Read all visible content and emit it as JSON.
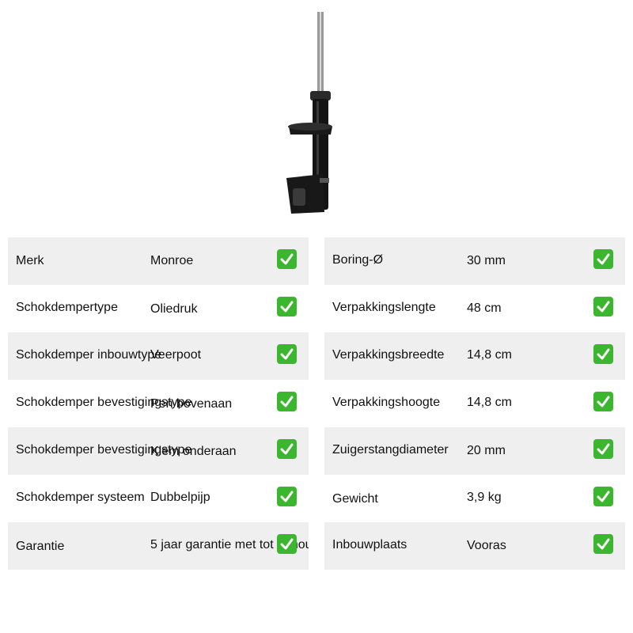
{
  "left_rows": [
    {
      "label": "Merk",
      "value": "Monroe"
    },
    {
      "label": "Schokdempertype",
      "value": "Oliedruk"
    },
    {
      "label": "Schokdemper inbouwtype",
      "value": "Veerpoot"
    },
    {
      "label": "Schokdemper bevestigingstype",
      "value": "Pen bovenaan"
    },
    {
      "label": "Schokdemper bevestigingstype",
      "value": "Klem onderaan"
    },
    {
      "label": "Schokdemper systeem",
      "value": "Dubbelpijp"
    },
    {
      "label": "Garantie",
      "value": "5 jaar garantie met tot behoud"
    }
  ],
  "right_rows": [
    {
      "label": "Boring-Ø",
      "value": "30 mm"
    },
    {
      "label": "Verpakkingslengte",
      "value": "48 cm"
    },
    {
      "label": "Verpakkingsbreedte",
      "value": "14,8 cm"
    },
    {
      "label": "Verpakkingshoogte",
      "value": "14,8 cm"
    },
    {
      "label": "Zuigerstangdiameter",
      "value": "20 mm"
    },
    {
      "label": "Gewicht",
      "value": "3,9 kg"
    },
    {
      "label": "Inbouwplaats",
      "value": "Vooras"
    }
  ],
  "colors": {
    "row_shade": "#efefef",
    "check_bg": "#3cb62e"
  },
  "icons": {
    "check": "check-mark-icon",
    "product": "shock-absorber-image"
  }
}
